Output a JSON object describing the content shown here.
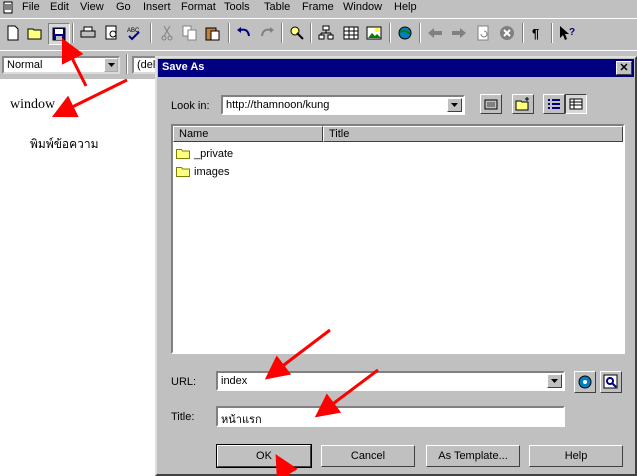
{
  "menu": [
    "File",
    "Edit",
    "View",
    "Go",
    "Insert",
    "Format",
    "Tools",
    "Table",
    "Frame",
    "Window",
    "Help"
  ],
  "format_bar": {
    "style_value": "Normal",
    "font_value": "(del"
  },
  "document": {
    "word": "window",
    "thai_text": "พิมพ์ข้อความ"
  },
  "dialog": {
    "title": "Save As",
    "look_in_label": "Look in:",
    "look_in_value": "http://thamnoon/kung",
    "columns": [
      "Name",
      "Title"
    ],
    "files": [
      "_private",
      "images"
    ],
    "url_label": "URL:",
    "url_value": "index",
    "title_label": "Title:",
    "title_value": "หน้าแรก",
    "buttons": {
      "ok": "OK",
      "cancel": "Cancel",
      "as_template": "As Template...",
      "help": "Help"
    }
  },
  "colors": {
    "titlebar": "#000080",
    "annotation_arrow": "#ff0000",
    "folder": "#ffff80"
  }
}
